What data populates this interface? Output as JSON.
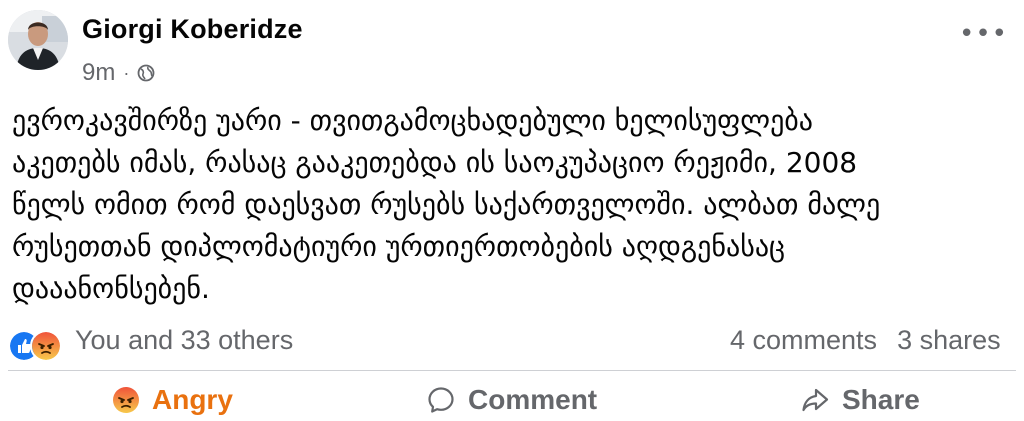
{
  "post": {
    "author": "Giorgi Koberidze",
    "time": "9m",
    "separator": "·",
    "body": "ევროკავშირზე უარი - თვითგამოცხადებული ხელისუფლება\nაკეთებს იმას, რასაც გააკეთებდა ის საოკუპაციო რეჟიმი, 2008\nწელს ომით რომ დაესვათ რუსებს საქართველოში. ალბათ მალე\nრუსეთთან დიპლომატიური ურთიერთობების აღდგენასაც\nდააანონსებენ."
  },
  "reactions": {
    "summary": "You and 33 others",
    "comments": "4 comments",
    "shares": "3 shares",
    "icons": [
      "like-icon",
      "angry-icon"
    ]
  },
  "actions": {
    "angry_label": "Angry",
    "comment_label": "Comment",
    "share_label": "Share"
  },
  "colors": {
    "angry": "#e9710f",
    "like_blue": "#1877f2",
    "muted": "#65676b"
  }
}
